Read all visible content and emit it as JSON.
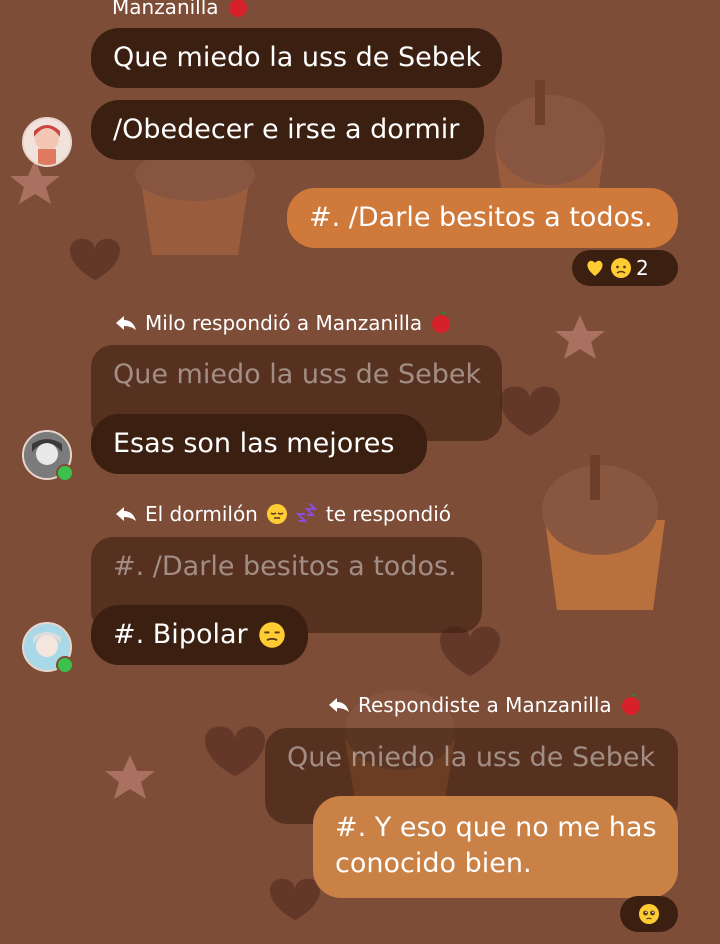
{
  "messages": {
    "m1": {
      "author": "Manzanilla",
      "text": "Que miedo la uss de Sebek"
    },
    "m2": {
      "text": "/Obedecer e irse a dormir"
    },
    "m3": {
      "text": "#. /Darle besitos a todos.",
      "reaction_count": "2"
    },
    "m4": {
      "reply_header": "Milo respondió a Manzanilla",
      "quote": "Que miedo la uss de Sebek",
      "text": "Esas son las mejores"
    },
    "m5": {
      "reply_header_name": "El dormilón",
      "reply_header_suffix": "te respondió",
      "quote": "#. /Darle besitos a todos.",
      "text": "#. Bipolar"
    },
    "m6": {
      "reply_header": "Respondiste a Manzanilla",
      "quote": "Que miedo la uss de Sebek",
      "text_line1": "#. Y eso que no me has",
      "text_line2": "conocido bien."
    }
  },
  "colors": {
    "background": "#7e4d38",
    "bubble_dark": "#3b1f10",
    "bubble_orange": "#cf7a3a",
    "online": "#3cc24b"
  },
  "icons": [
    "reply-arrow-icon",
    "apple-icon",
    "yellow-heart-icon",
    "worried-face-icon",
    "sleepy-face-icon",
    "zzz-icon",
    "unamused-face-icon",
    "pleading-face-icon"
  ]
}
